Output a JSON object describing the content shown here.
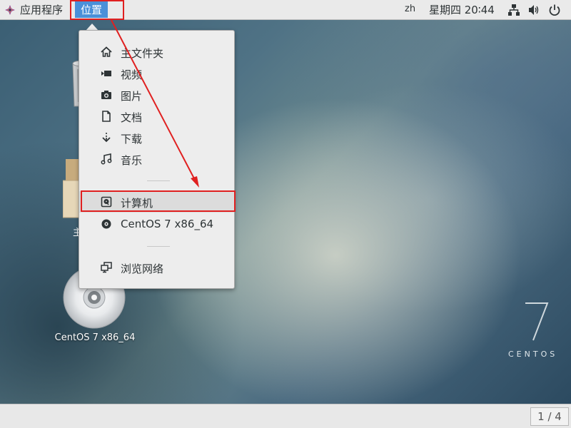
{
  "topbar": {
    "apps_label": "应用程序",
    "places_label": "位置",
    "lang": "zh",
    "clock": "星期四 20∶44",
    "icons": [
      "network-icon",
      "volume-icon",
      "power-icon"
    ]
  },
  "desktop": {
    "folder_label": "主",
    "dvd_label": "CentOS 7 x86_64",
    "brand_number": "7",
    "brand_text": "CENTOS"
  },
  "menu": {
    "items": [
      {
        "label": "主文件夹",
        "icon": "home-icon"
      },
      {
        "label": "视频",
        "icon": "video-icon"
      },
      {
        "label": "图片",
        "icon": "camera-icon"
      },
      {
        "label": "文档",
        "icon": "document-icon"
      },
      {
        "label": "下载",
        "icon": "download-icon"
      },
      {
        "label": "音乐",
        "icon": "music-icon"
      }
    ],
    "computer_label": "计算机",
    "disc_label": "CentOS 7 x86_64",
    "network_label": "浏览网络"
  },
  "bottombar": {
    "workspace": "1 / 4"
  },
  "colors": {
    "highlight": "#4a90d9",
    "annotation": "#e02020"
  }
}
